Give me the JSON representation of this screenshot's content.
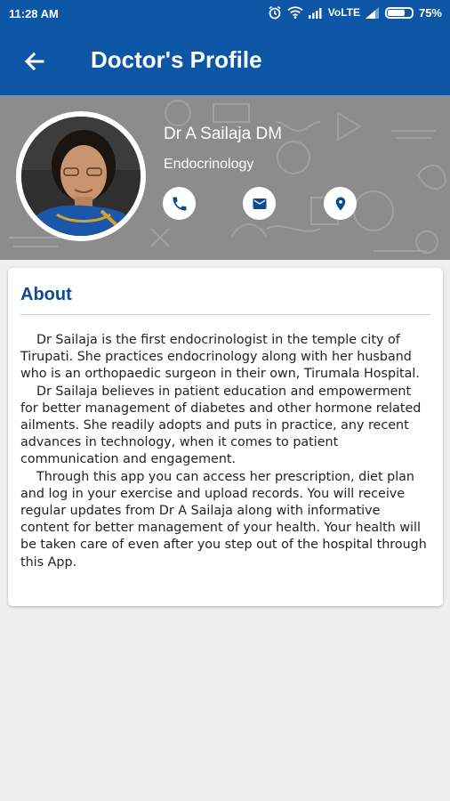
{
  "status_bar": {
    "time": "11:28 AM",
    "carrier": "VoLTE",
    "battery": "75%",
    "battery_level": 0.75
  },
  "app_bar": {
    "title": "Doctor's Profile",
    "back_icon": "arrow-left-icon"
  },
  "profile": {
    "name": "Dr A Sailaja DM",
    "specialty": "Endocrinology",
    "actions": [
      {
        "icon": "phone-icon"
      },
      {
        "icon": "email-icon"
      },
      {
        "icon": "location-icon"
      }
    ]
  },
  "about": {
    "heading": "About",
    "paragraphs": [
      "Dr Sailaja is the first endocrinologist in the temple city of Tirupati. She practices endocrinology along with her husband who is an orthopaedic surgeon in their own, Tirumala Hospital.",
      "Dr Sailaja believes in patient education and empowerment for better management of diabetes and other hormone related ailments. She readily adopts and puts in practice, any recent advances in technology, when it comes to patient communication and engagement.",
      "Through this app you can access her prescription, diet plan and log in your exercise and upload records. You will receive regular updates from Dr A Sailaja along with informative content for better management of your health. Your health will be taken care of even after you step out of the hospital through this App."
    ]
  },
  "colors": {
    "primary": "#0d56a6",
    "heading": "#0d4a8f",
    "hero_background": "#8c8c8c",
    "page_background": "#efefef"
  }
}
